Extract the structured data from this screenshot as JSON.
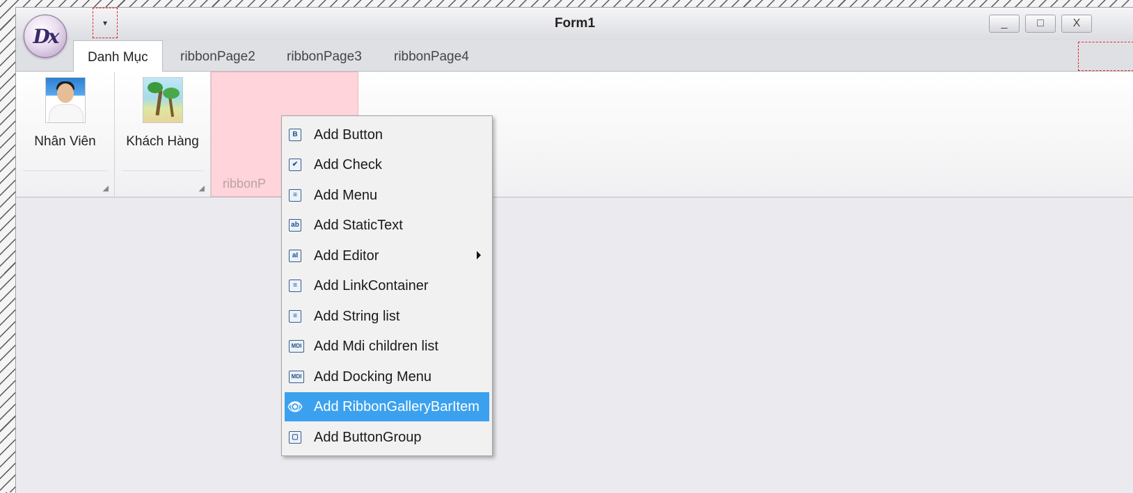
{
  "window": {
    "title": "Form1",
    "logo_text": "Dx",
    "qat_glyph": "▾",
    "controls": {
      "minimize": "_",
      "maximize": "□",
      "close": "X"
    }
  },
  "ribbon": {
    "tabs": [
      {
        "label": "Danh Mục",
        "active": true
      },
      {
        "label": "ribbonPage2",
        "active": false
      },
      {
        "label": "ribbonPage3",
        "active": false
      },
      {
        "label": "ribbonPage4",
        "active": false
      }
    ],
    "groups": [
      {
        "button_label": "Nhân Viên",
        "icon": "employee-photo-icon"
      },
      {
        "button_label": "Khách Hàng",
        "icon": "beach-picture-icon"
      }
    ],
    "selected_group_caption": "ribbonP"
  },
  "context_menu": {
    "items": [
      {
        "label": "Add Button",
        "icon": "B"
      },
      {
        "label": "Add Check",
        "icon": "✔"
      },
      {
        "label": "Add Menu",
        "icon": "≡"
      },
      {
        "label": "Add StaticText",
        "icon": "ab"
      },
      {
        "label": "Add Editor",
        "icon": "aI"
      },
      {
        "label": "Add LinkContainer",
        "icon": "≡"
      },
      {
        "label": "Add String list",
        "icon": "≡"
      },
      {
        "label": "Add Mdi children list",
        "icon": "MDI"
      },
      {
        "label": "Add Docking Menu",
        "icon": "MDI"
      },
      {
        "label": "Add RibbonGalleryBarItem",
        "icon": "👁"
      },
      {
        "label": "Add ButtonGroup",
        "icon": "▢"
      }
    ],
    "highlighted_index": 9,
    "colors": {
      "highlight": "#3ba1ee"
    }
  },
  "colors": {
    "selected_group": "#ffd4da",
    "designer_dash": "#e02020"
  }
}
